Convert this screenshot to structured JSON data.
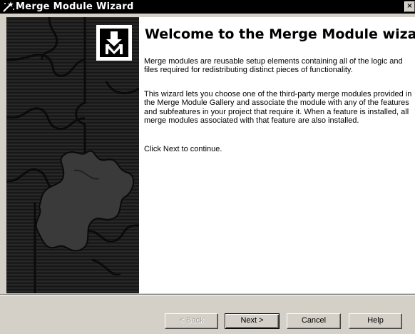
{
  "window": {
    "title": "Merge Module Wizard",
    "close_glyph": "×",
    "title_icon": "wizard-wand-icon"
  },
  "side_panel": {
    "logo_icon": "merge-module-icon",
    "background": "puzzle-pieces"
  },
  "content": {
    "heading": "Welcome to the Merge Module wizard",
    "paragraphs": [
      "Merge modules are reusable setup elements containing all of the logic and files required for redistributing distinct pieces of functionality.",
      "This wizard lets you choose one of the third-party merge modules provided in the Merge Module Gallery and associate the module with any of the features and subfeatures in your project that require it. When a feature is installed, all merge modules associated with that feature are also installed.",
      "Click Next to continue."
    ]
  },
  "buttons": {
    "back": "< Back",
    "next": "Next >",
    "cancel": "Cancel",
    "help": "Help"
  },
  "colors": {
    "titlebar_bg": "#000000",
    "titlebar_text": "#ffffff",
    "dialog_face": "#d4d0c8",
    "content_bg": "#ffffff",
    "side_panel_bg": "#1a1a1a"
  }
}
